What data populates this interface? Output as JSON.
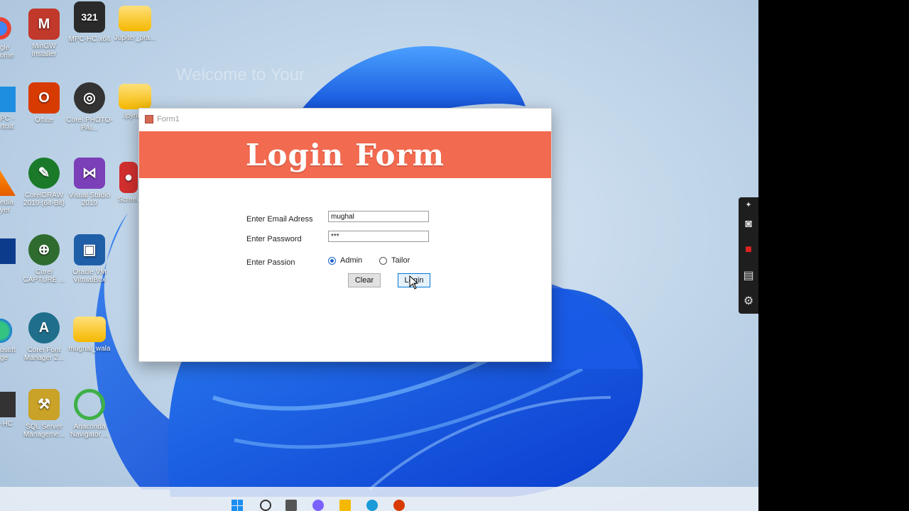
{
  "desktop": {
    "faded_text": "Welcome to Your",
    "icons": [
      {
        "label": "MinGW Installer",
        "icon": "mingw-icon",
        "color": "#c0392b"
      },
      {
        "label": "MPC-HC x64",
        "icon": "mpc-hc-icon",
        "color": "#2a2a2a"
      },
      {
        "label": "Jupiter_pra...",
        "icon": "folder-icon",
        "color": "#f5b800"
      },
      {
        "label": "Office",
        "icon": "office-icon",
        "color": "#d83b01"
      },
      {
        "label": "Corel PHOTO-PAI...",
        "icon": "corel-photo-paint-icon",
        "color": "#333333"
      },
      {
        "label": ".ipynb...",
        "icon": "folder-icon",
        "color": "#f5b800"
      },
      {
        "label": "CorelDRAW 2019 (64-Bit)",
        "icon": "coreldraw-icon",
        "color": "#1a7a2a"
      },
      {
        "label": "Visual Studio 2019",
        "icon": "visual-studio-icon",
        "color": "#7b3fb8"
      },
      {
        "label": "Screen...",
        "icon": "screen-recorder-icon",
        "color": "#d32f2f"
      },
      {
        "label": "Corel CAPTURE ...",
        "icon": "corel-capture-icon",
        "color": "#2f6b2f"
      },
      {
        "label": "Oracle VM VirtualBox",
        "icon": "virtualbox-icon",
        "color": "#1f5fa8"
      },
      {
        "label": "Corel Font Manager 2...",
        "icon": "corel-font-manager-icon",
        "color": "#1f6e8c"
      },
      {
        "label": "mughal_wala",
        "icon": "folder-icon",
        "color": "#f5b800"
      },
      {
        "label": "SQL Server Manageme...",
        "icon": "sql-server-icon",
        "color": "#c9a227"
      },
      {
        "label": "Anaconda Navigator ...",
        "icon": "anaconda-icon",
        "color": "#3eb049"
      }
    ],
    "partial_labels": [
      "gle\nome",
      "PC -\nrtcut",
      "edia\nyer",
      " ",
      "osoft\nge",
      "-HC"
    ]
  },
  "window": {
    "title": "Form1",
    "banner": "Login Form",
    "email_label": "Enter Email Adress",
    "email_value": "mughal",
    "password_label": "Enter Password",
    "password_value": "***",
    "passion_label": "Enter Passion",
    "radio_admin": "Admin",
    "radio_tailor": "Tailor",
    "selected_radio": "Admin",
    "clear_button": "Clear",
    "login_button": "Login",
    "colors": {
      "banner": "#f26a4f",
      "radio_selected": "#1c64c8"
    }
  },
  "side_toolbar": {
    "items": [
      "pin-icon",
      "camera-icon",
      "record-icon",
      "gallery-icon",
      "gear-icon"
    ]
  },
  "taskbar": {
    "items": [
      "windows-start-icon",
      "search-icon",
      "task-view-icon",
      "chat-icon",
      "file-explorer-icon",
      "edge-icon",
      "app-icon"
    ]
  }
}
